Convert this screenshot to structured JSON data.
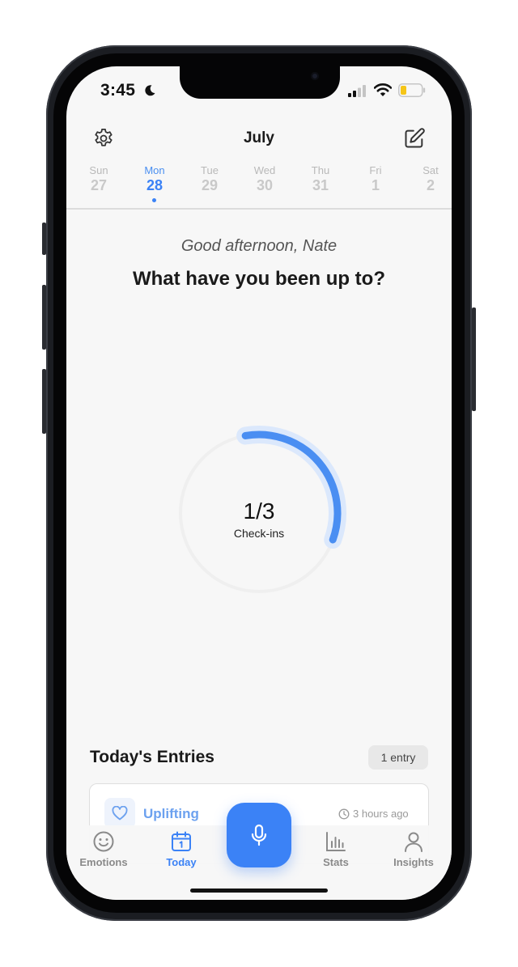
{
  "status_bar": {
    "time": "3:45"
  },
  "header": {
    "month": "July"
  },
  "week": [
    {
      "name": "Sun",
      "num": "27"
    },
    {
      "name": "Mon",
      "num": "28"
    },
    {
      "name": "Tue",
      "num": "29"
    },
    {
      "name": "Wed",
      "num": "30"
    },
    {
      "name": "Thu",
      "num": "31"
    },
    {
      "name": "Fri",
      "num": "1"
    },
    {
      "name": "Sat",
      "num": "2"
    }
  ],
  "greeting": "Good afternoon, Nate",
  "headline": "What have you been up to?",
  "checkins": {
    "count_text": "1/3",
    "label": "Check-ins",
    "progress": 0.333
  },
  "entries": {
    "title": "Today's Entries",
    "badge": "1 entry",
    "items": [
      {
        "title": "Uplifting",
        "time": "3 hours ago"
      }
    ]
  },
  "tabs": [
    {
      "label": "Emotions"
    },
    {
      "label": "Today"
    },
    {
      "label": "Stats"
    },
    {
      "label": "Insights"
    }
  ],
  "colors": {
    "accent": "#3b82f6",
    "accent_light": "#dbe8fc",
    "track": "#efefef"
  },
  "icons": [
    "moon-icon",
    "signal-icon",
    "wifi-icon",
    "battery-icon",
    "gear-icon",
    "edit-icon",
    "heart-icon",
    "clock-icon",
    "smile-icon",
    "calendar-icon",
    "mic-icon",
    "bar-chart-icon",
    "person-icon"
  ]
}
